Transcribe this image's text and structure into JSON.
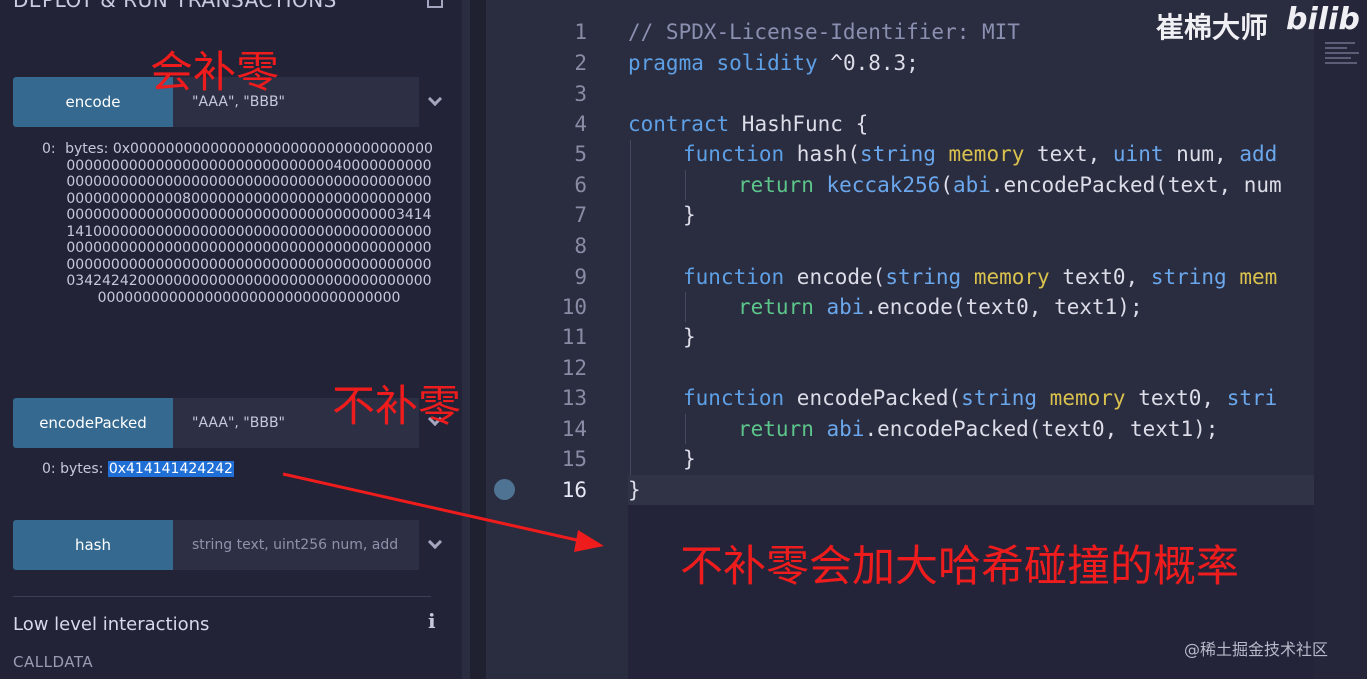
{
  "panel": {
    "title": "DEPLOY & RUN TRANSACTIONS",
    "functions": [
      {
        "button": "encode",
        "input": "\"AAA\", \"BBB\""
      },
      {
        "button": "encodePacked",
        "input": "\"AAA\", \"BBB\""
      },
      {
        "button": "hash",
        "input": "string text, uint256 num, add"
      }
    ],
    "encode_output_prefix": "0:",
    "encode_output": "bytes: 0x000000000000000000000000000000000000000000000000000000000000000040000000000000000000000000000000000000000000000000000000000000000800000000000000000000000000000000000000000000000000000000000000003414141000000000000000000000000000000000000000000000000000000000000000000000000000000000000000000000000000000000000000000000000034242420000000000000000000000000000000000000000000000000000000000000000000",
    "packed_prefix": "0: bytes: ",
    "packed_value": "0x414141424242",
    "low_level_title": "Low level interactions",
    "info_icon": "i",
    "calldata_label": "CALLDATA"
  },
  "editor": {
    "line_numbers": [
      "1",
      "2",
      "3",
      "4",
      "5",
      "6",
      "7",
      "8",
      "9",
      "10",
      "11",
      "12",
      "13",
      "14",
      "15",
      "16"
    ],
    "active_line": "16",
    "lines": {
      "l1": "// SPDX-License-Identifier: MIT",
      "l2a": "pragma solidity",
      "l2b": " ^0.8.3;",
      "l4a": "contract",
      "l4b": " HashFunc {",
      "l5a": "function",
      "l5b": " hash(",
      "l5c": "string",
      "l5d": " memory",
      "l5e": " text, ",
      "l5f": "uint",
      "l5g": " num, ",
      "l5h": "add",
      "l6a": "return",
      "l6b": " keccak256",
      "l6c": "(",
      "l6d": "abi",
      "l6e": ".encodePacked(text, num",
      "l7": "}",
      "l9a": "function",
      "l9b": " encode(",
      "l9c": "string",
      "l9d": " memory",
      "l9e": " text0, ",
      "l9f": "string",
      "l9g": " mem",
      "l10a": "return",
      "l10b": " abi",
      "l10c": ".encode(text0, text1);",
      "l11": "}",
      "l13a": "function",
      "l13b": " encodePacked(",
      "l13c": "string",
      "l13d": " memory",
      "l13e": " text0, ",
      "l13f": "stri",
      "l14a": "return",
      "l14b": " abi",
      "l14c": ".encodePacked(text0, text1);",
      "l15": "}",
      "l16": "}"
    }
  },
  "annotations": {
    "pad": "会补零",
    "no_pad": "不补零",
    "collision": "不补零会加大哈希碰撞的概率"
  },
  "watermarks": {
    "top_text": "崔棉大师",
    "logo": "bilib",
    "bottom": "@稀土掘金技术社区"
  },
  "colors": {
    "button": "#35698f",
    "annotation": "#ee1c1c",
    "selection": "#1f6fd6"
  }
}
